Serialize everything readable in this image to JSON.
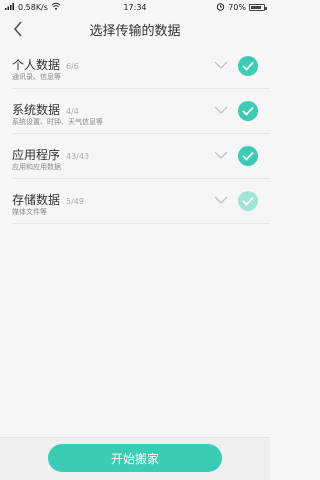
{
  "status": {
    "speed": "0.58K/s",
    "time": "17:34",
    "battery": "70%"
  },
  "header": {
    "title": "选择传输的数据"
  },
  "items": [
    {
      "title": "个人数据",
      "count": "6/6",
      "subtitle": "通讯录、信息等",
      "state": "checked"
    },
    {
      "title": "系统数据",
      "count": "4/4",
      "subtitle": "系统设置、时钟、天气信息等",
      "state": "checked"
    },
    {
      "title": "应用程序",
      "count": "43/43",
      "subtitle": "应用和应用数据",
      "state": "checked"
    },
    {
      "title": "存储数据",
      "count": "5/49",
      "subtitle": "媒体文件等",
      "state": "partial"
    }
  ],
  "footer": {
    "start_label": "开始搬家"
  },
  "colors": {
    "accent": "#3ccbb4",
    "accent_light": "#a3e3d8"
  }
}
